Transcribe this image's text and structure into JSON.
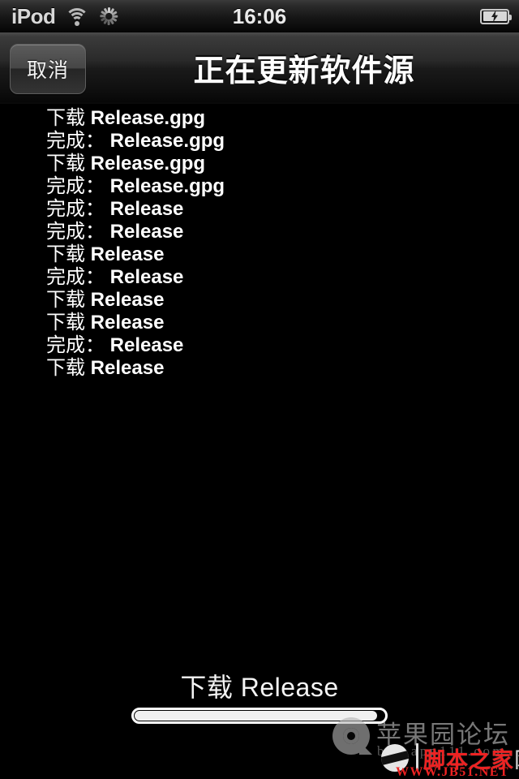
{
  "status_bar": {
    "carrier": "iPod",
    "time": "16:06",
    "wifi_icon": "wifi-icon",
    "activity_icon": "network-activity-spinner-icon",
    "battery_icon": "battery-charging-icon",
    "battery_bolt": "⚡"
  },
  "nav_bar": {
    "cancel_label": "取消",
    "title": "正在更新软件源"
  },
  "log": {
    "lines": [
      {
        "prefix": "下载 ",
        "target": "Release.gpg"
      },
      {
        "prefix": "完成：",
        "target": "Release.gpg"
      },
      {
        "prefix": "下载 ",
        "target": "Release.gpg"
      },
      {
        "prefix": "完成：",
        "target": "Release.gpg"
      },
      {
        "prefix": "完成：",
        "target": "Release"
      },
      {
        "prefix": "完成：",
        "target": "Release"
      },
      {
        "prefix": "下载 ",
        "target": "Release"
      },
      {
        "prefix": "完成：",
        "target": "Release"
      },
      {
        "prefix": "下载 ",
        "target": "Release"
      },
      {
        "prefix": "下载 ",
        "target": "Release"
      },
      {
        "prefix": "完成：",
        "target": "Release"
      },
      {
        "prefix": "下载 ",
        "target": "Release"
      }
    ]
  },
  "progress": {
    "status_text": "下载 Release",
    "percent": 97
  },
  "watermarks": {
    "apple": {
      "name": "苹果园论坛",
      "url": "bbs.app111.com"
    },
    "jb51": {
      "name": "脚本之家",
      "name_tail": "网",
      "url": "WWW.JB51.NET"
    }
  },
  "colors": {
    "background": "#000000",
    "text": "#ffffff",
    "navbar_top": "#4c4c4c",
    "progress_fill": "#f0f0f0",
    "jb51_red": "#ee2222"
  }
}
